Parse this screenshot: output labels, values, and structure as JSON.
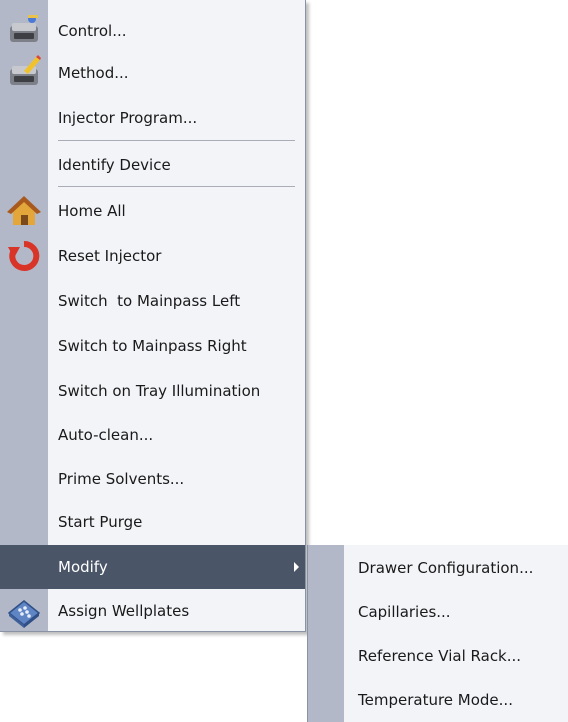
{
  "menu": {
    "items": [
      {
        "label": "Control...",
        "icon": "control-icon"
      },
      {
        "label": "Method...",
        "icon": "method-icon"
      },
      {
        "label": "Injector Program..."
      },
      {
        "label": "Identify Device"
      },
      {
        "label": "Home All",
        "icon": "home-icon"
      },
      {
        "label": "Reset Injector",
        "icon": "reset-icon"
      },
      {
        "label": "Switch  to Mainpass Left"
      },
      {
        "label": "Switch to Mainpass Right"
      },
      {
        "label": "Switch on Tray Illumination"
      },
      {
        "label": "Auto-clean..."
      },
      {
        "label": "Prime Solvents..."
      },
      {
        "label": "Start Purge"
      },
      {
        "label": "Modify",
        "highlighted": true,
        "has_submenu": true
      },
      {
        "label": "Assign Wellplates",
        "icon": "wellplate-icon"
      }
    ]
  },
  "submenu": {
    "items": [
      {
        "label": "Drawer Configuration..."
      },
      {
        "label": "Capillaries..."
      },
      {
        "label": "Reference Vial Rack..."
      },
      {
        "label": "Temperature Mode..."
      }
    ]
  },
  "colors": {
    "menu_background": "#f2f4f8",
    "gutter": "#b3b8c9",
    "highlight": "#4b5568"
  }
}
